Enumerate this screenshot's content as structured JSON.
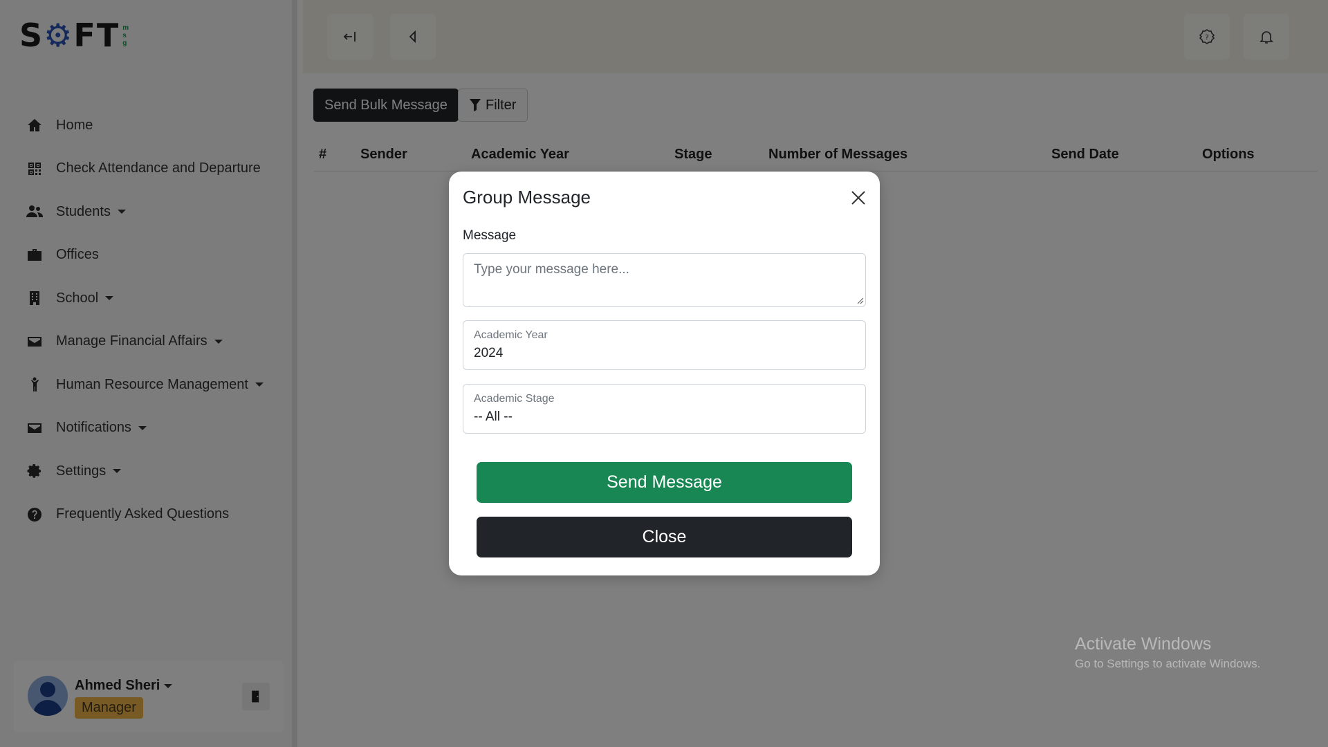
{
  "app": {
    "logo_text_1": "S",
    "logo_text_2": "FT",
    "logo_sub": [
      "m",
      "s",
      "g"
    ]
  },
  "sidebar": {
    "items": [
      {
        "label": "Home",
        "icon": "home-icon",
        "dropdown": false
      },
      {
        "label": "Check Attendance and Departure",
        "icon": "qr-code-icon",
        "dropdown": false
      },
      {
        "label": "Students",
        "icon": "users-icon",
        "dropdown": true
      },
      {
        "label": "Offices",
        "icon": "briefcase-icon",
        "dropdown": false
      },
      {
        "label": "School",
        "icon": "building-icon",
        "dropdown": true
      },
      {
        "label": "Manage Financial Affairs",
        "icon": "wallet-icon",
        "dropdown": true
      },
      {
        "label": "Human Resource Management",
        "icon": "person-icon",
        "dropdown": true
      },
      {
        "label": "Notifications",
        "icon": "inbox-icon",
        "dropdown": true
      },
      {
        "label": "Settings",
        "icon": "gear-icon",
        "dropdown": true
      },
      {
        "label": "Frequently Asked Questions",
        "icon": "question-circle-icon",
        "dropdown": false
      }
    ]
  },
  "user": {
    "name": "Ahmed Sheri",
    "role": "Manager"
  },
  "toolbar": {
    "send_bulk_label": "Send Bulk Message",
    "filter_label": "Filter"
  },
  "table": {
    "headers": [
      "#",
      "Sender",
      "Academic Year",
      "Stage",
      "Number of Messages",
      "Send Date",
      "Options"
    ]
  },
  "modal": {
    "title": "Group Message",
    "message_label": "Message",
    "message_placeholder": "Type your message here...",
    "year_label": "Academic Year",
    "year_value": "2024",
    "stage_label": "Academic Stage",
    "stage_value": "-- All --",
    "send_label": "Send Message",
    "close_label": "Close"
  },
  "watermark": {
    "title": "Activate Windows",
    "subtitle": "Go to Settings to activate Windows."
  },
  "colors": {
    "primary_dark": "#212529",
    "success": "#198754",
    "badge": "#f0b54a"
  }
}
